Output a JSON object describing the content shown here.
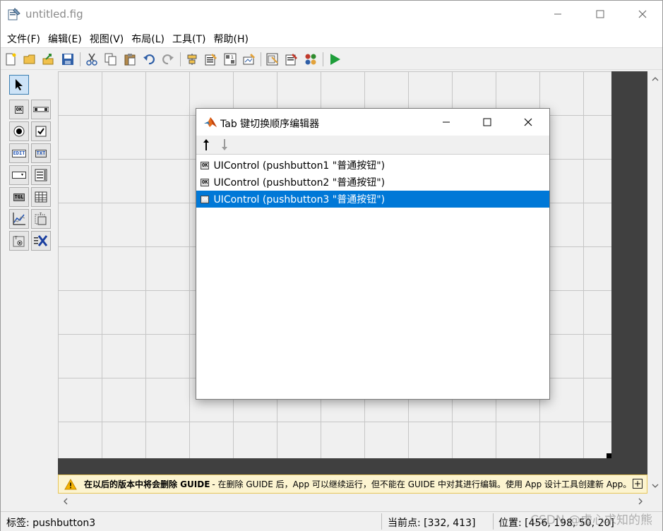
{
  "window": {
    "title": "untitled.fig"
  },
  "menu": [
    "文件(F)",
    "编辑(E)",
    "视图(V)",
    "布局(L)",
    "工具(T)",
    "帮助(H)"
  ],
  "toolbar": {
    "icons": [
      "new-file-icon",
      "open-folder-icon",
      "export-icon",
      "save-icon",
      "cut-icon",
      "copy-icon",
      "paste-icon",
      "undo-icon",
      "redo-icon",
      "align-icon",
      "menu-editor-icon",
      "tab-order-icon",
      "toolbar-editor-icon",
      "editor-icon",
      "property-inspector-icon",
      "object-browser-icon",
      "run-icon"
    ]
  },
  "palette": {
    "ok_label": "OK",
    "edit_label": "EDIT",
    "txt_label": "TXT",
    "tgl_label": "TGL",
    "items": [
      "select-tool",
      "push-button",
      "slider",
      "radio-button",
      "checkbox",
      "edit-text",
      "static-text",
      "popup-menu",
      "listbox",
      "toggle-button",
      "table",
      "axes",
      "panel",
      "button-group",
      "activex-control"
    ]
  },
  "dialog": {
    "title": "Tab 键切换顺序编辑器",
    "rows": [
      {
        "chip": "OK",
        "label": "UIControl (pushbutton1 \"普通按钮\")",
        "selected": false
      },
      {
        "chip": "OK",
        "label": "UIControl (pushbutton2 \"普通按钮\")",
        "selected": false
      },
      {
        "chip": "OK",
        "label": "UIControl (pushbutton3 \"普通按钮\")",
        "selected": true
      }
    ]
  },
  "banner": {
    "bold": "在以后的版本中将会删除 GUIDE",
    "text": " - 在删除 GUIDE 后，App 可以继续运行，但不能在 GUIDE 中对其进行编辑。使用 App 设计工具创建新 App。",
    "expand": "+"
  },
  "status": {
    "tag": "标签: pushbutton3",
    "current_point": "当前点:  [332, 413]",
    "position": "位置: [456, 198, 50, 20]"
  },
  "watermark": "CSDN @虚心求知的熊",
  "colors": {
    "selection": "#0078d7",
    "canvas_border": "#404040",
    "banner_bg": "#fcf4d0"
  }
}
